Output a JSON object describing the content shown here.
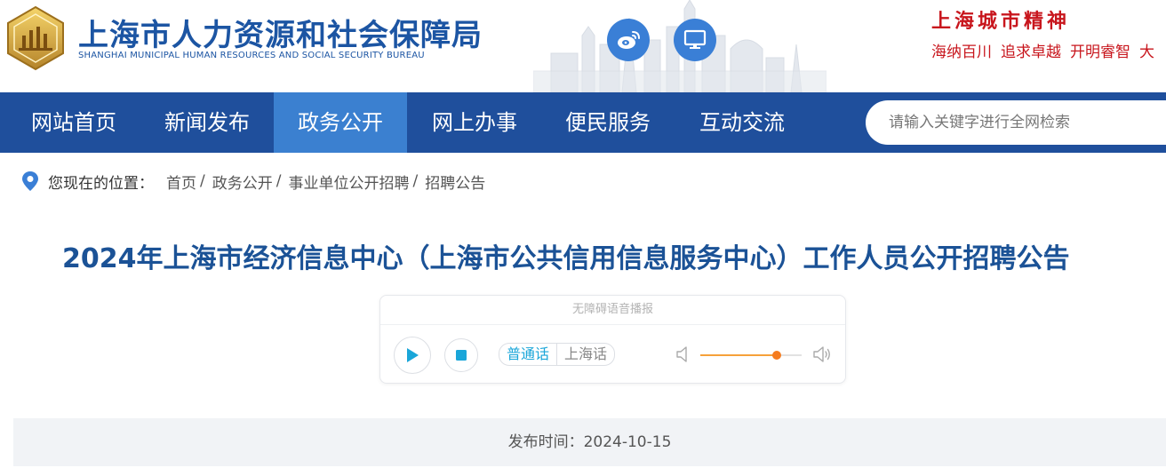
{
  "header": {
    "site_name_cn": "上海市人力资源和社会保障局",
    "site_name_en": "SHANGHAI MUNICIPAL HUMAN RESOURCES AND SOCIAL SECURITY BUREAU",
    "emblem_icon": "bureau-emblem-icon",
    "social_buttons": [
      "weibo-icon",
      "computer-monitor-icon"
    ],
    "city_spirit": {
      "title": "上海城市精神",
      "items": [
        "海纳百川",
        "追求卓越",
        "开明睿智",
        "大"
      ]
    }
  },
  "nav": {
    "items": [
      {
        "label": "网站首页",
        "active": false
      },
      {
        "label": "新闻发布",
        "active": false
      },
      {
        "label": "政务公开",
        "active": true
      },
      {
        "label": "网上办事",
        "active": false
      },
      {
        "label": "便民服务",
        "active": false
      },
      {
        "label": "互动交流",
        "active": false
      }
    ],
    "search_placeholder": "请输入关键字进行全网检索"
  },
  "breadcrumb": {
    "prefix": "您现在的位置：",
    "items": [
      "首页",
      "政务公开",
      "事业单位公开招聘",
      "招聘公告"
    ],
    "separator": "/"
  },
  "article": {
    "title": "2024年上海市经济信息中心（上海市公共信用信息服务中心）工作人员公开招聘公告",
    "publish_label": "发布时间：",
    "publish_date": "2024-10-15"
  },
  "audio_player": {
    "header": "无障碍语音播报",
    "languages": [
      {
        "label": "普通话",
        "selected": true
      },
      {
        "label": "上海话",
        "selected": false
      }
    ],
    "volume_fraction": 0.75,
    "colors": {
      "accent": "#1aa6d9",
      "volume": "#f57c1f"
    }
  },
  "colors": {
    "nav_bg": "#1f4f9c",
    "nav_active": "#3b80d0",
    "title": "#1b5296",
    "spirit": "#c8161d"
  }
}
